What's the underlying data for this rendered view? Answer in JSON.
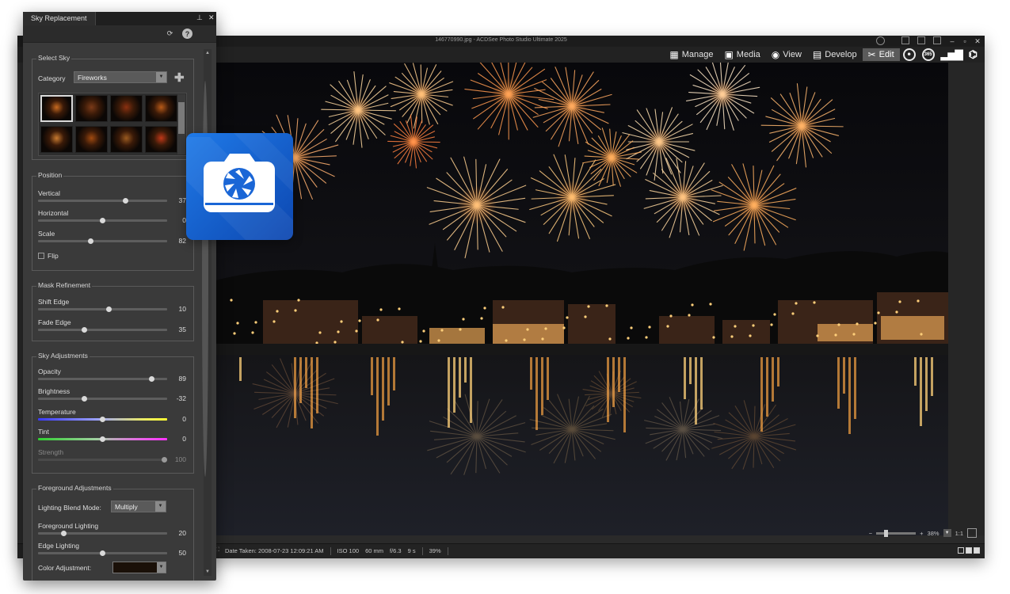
{
  "app": {
    "window_title": "146770990.jpg - ACDSee Photo Studio Ultimate 2025",
    "modes": [
      {
        "label": "Manage",
        "icon": "grid-icon"
      },
      {
        "label": "Media",
        "icon": "media-icon"
      },
      {
        "label": "View",
        "icon": "eye-icon"
      },
      {
        "label": "Develop",
        "icon": "develop-icon"
      },
      {
        "label": "Edit",
        "icon": "edit-tools-icon",
        "active": true
      }
    ],
    "extra_mode_icons": [
      "people-icon",
      "365-icon",
      "dashboard-icon",
      "ai-icon"
    ],
    "extra_mode_icon_text": {
      "365": "365"
    }
  },
  "status": {
    "date_taken": "Date Taken: 2008-07-23 12:09:21 AM",
    "iso": "ISO 100",
    "focal": "60 mm",
    "aperture": "f/6.3",
    "shutter": "9 s",
    "zoom_status": "39%",
    "zoom_value": "38%",
    "ratio_label": "1:1"
  },
  "panel": {
    "tab_title": "Sky Replacement",
    "select_sky": {
      "heading": "Select Sky",
      "category_label": "Category",
      "category_value": "Fireworks",
      "thumb_colors": [
        "#c86a20",
        "#7a3a18",
        "#8a3010",
        "#b85a18",
        "#c87a30",
        "#a04a10",
        "#9a5a20",
        "#c03818"
      ]
    },
    "position": {
      "heading": "Position",
      "sliders": [
        {
          "label": "Vertical",
          "value": "37",
          "pos": 0.68
        },
        {
          "label": "Horizontal",
          "value": "0",
          "pos": 0.5
        },
        {
          "label": "Scale",
          "value": "82",
          "pos": 0.41
        }
      ],
      "flip_label": "Flip"
    },
    "mask": {
      "heading": "Mask Refinement",
      "sliders": [
        {
          "label": "Shift Edge",
          "value": "10",
          "pos": 0.55
        },
        {
          "label": "Fade Edge",
          "value": "35",
          "pos": 0.36
        }
      ]
    },
    "sky_adj": {
      "heading": "Sky Adjustments",
      "sliders": [
        {
          "label": "Opacity",
          "value": "89",
          "pos": 0.88
        },
        {
          "label": "Brightness",
          "value": "-32",
          "pos": 0.36
        },
        {
          "label": "Temperature",
          "value": "0",
          "pos": 0.5
        },
        {
          "label": "Tint",
          "value": "0",
          "pos": 0.5
        },
        {
          "label": "Strength",
          "value": "100",
          "pos": 0.98
        }
      ]
    },
    "fg_adj": {
      "heading": "Foreground Adjustments",
      "blend_label": "Lighting Blend Mode:",
      "blend_value": "Multiply",
      "sliders": [
        {
          "label": "Foreground Lighting",
          "value": "20",
          "pos": 0.2
        },
        {
          "label": "Edge Lighting",
          "value": "50",
          "pos": 0.5
        }
      ],
      "color_label": "Color Adjustment:"
    }
  },
  "colors": {
    "accent_edit": "#5b5b5b",
    "panel_bg": "#3a3a3a",
    "logo_blue": "#1a66d6"
  }
}
